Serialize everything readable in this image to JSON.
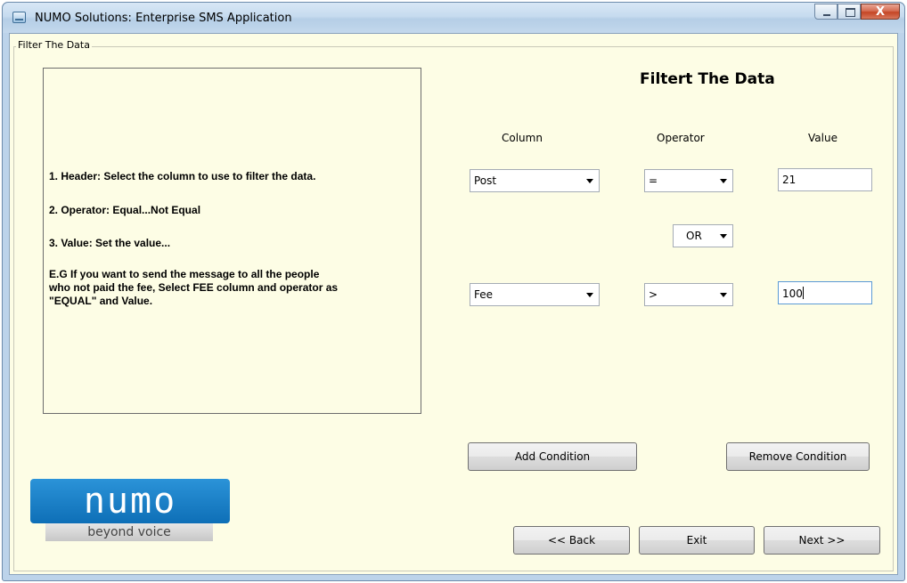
{
  "window": {
    "title": "NUMO Solutions: Enterprise SMS Application",
    "close_glyph": "X"
  },
  "group": {
    "title": "Filter The Data"
  },
  "help": {
    "line1": "1. Header: Select the column to use to filter the data.",
    "line2": "2. Operator: Equal...Not Equal",
    "line3": "3. Value: Set the value...",
    "line4": "E.G If you want to send the message to all the people\nwho not paid the fee, Select FEE column and operator as\n\"EQUAL\" and Value."
  },
  "heading": "Filtert The Data",
  "columns": {
    "column": "Column",
    "operator": "Operator",
    "value": "Value"
  },
  "condition1": {
    "column": "Post",
    "operator": "=",
    "value": "21"
  },
  "joiner": "OR",
  "condition2": {
    "column": "Fee",
    "operator": ">",
    "value": "100"
  },
  "buttons": {
    "add": "Add Condition",
    "remove": "Remove Condition",
    "back": "<< Back",
    "exit": "Exit",
    "next": "Next >>"
  },
  "logo": {
    "brand": "numo",
    "tagline": "beyond voice",
    "color": "#1a84cf"
  }
}
